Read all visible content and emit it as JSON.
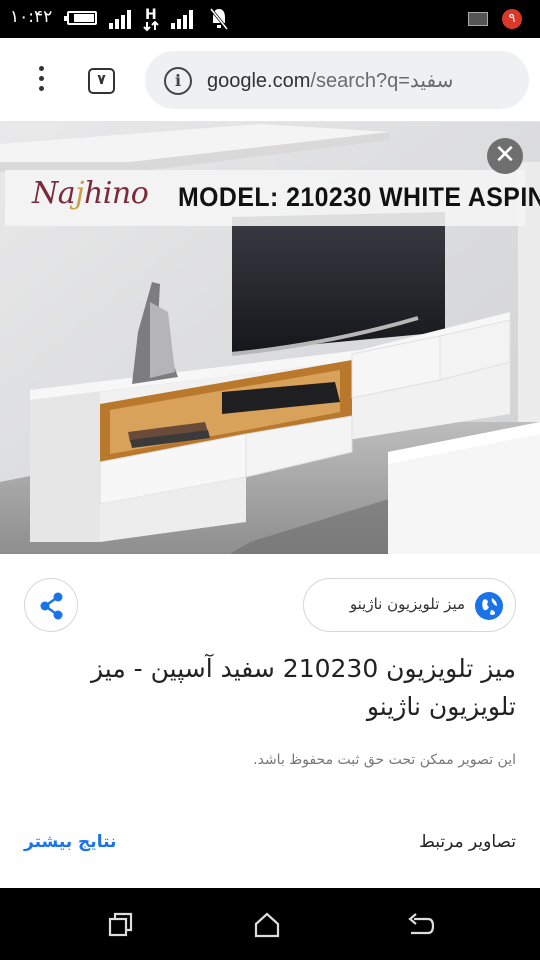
{
  "status_bar": {
    "time": "۱۰:۴۲",
    "notification_badge": "۹",
    "icons": [
      "battery-icon",
      "signal-icon",
      "data-h-icon",
      "signal-icon",
      "mute-icon",
      "message-icon"
    ]
  },
  "browser": {
    "menu_icon": "more-vert-icon",
    "tab_count": "۷",
    "url_domain": "google.com",
    "url_path": "/search?q=سفید",
    "info_icon": "info-icon"
  },
  "image": {
    "logo_text_main": "Na",
    "logo_text_j": "j",
    "logo_text_end": "hino",
    "banner_text": "MODEL: 210230 WHITE ASPIN",
    "close_icon": "close-icon"
  },
  "info": {
    "source_label": "میز تلویزیون ناژینو",
    "title": "میز تلویزیون 210230 سفید آسپین - میز تلویزیون ناژینو",
    "copyright": "این تصویر ممکن تحت حق ثبت محفوظ باشد.",
    "related_label": "تصاویر مرتبط",
    "more_label": "نتایج بیشتر",
    "share_icon": "share-icon",
    "globe_icon": "globe-icon"
  },
  "nav": {
    "buttons": [
      "recents-icon",
      "home-icon",
      "back-icon"
    ]
  },
  "colors": {
    "accent": "#1a73e8",
    "status_badge": "#d8392a",
    "logo": "#7a2a3a"
  }
}
